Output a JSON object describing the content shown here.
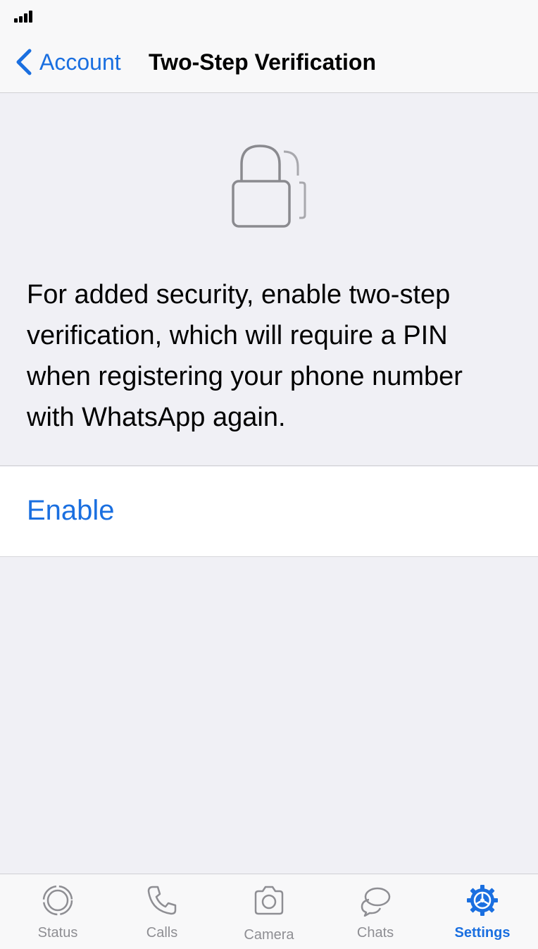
{
  "nav": {
    "back_label": "Account",
    "title": "Two-Step Verification"
  },
  "info": {
    "icon": "lock-icon",
    "description": "For added security, enable two-step verification, which will require a PIN when registering your phone number with WhatsApp again."
  },
  "actions": {
    "enable_label": "Enable"
  },
  "tabs": [
    {
      "label": "Status",
      "icon": "status-icon",
      "active": false
    },
    {
      "label": "Calls",
      "icon": "phone-icon",
      "active": false
    },
    {
      "label": "Camera",
      "icon": "camera-icon",
      "active": false
    },
    {
      "label": "Chats",
      "icon": "chat-bubbles-icon",
      "active": false
    },
    {
      "label": "Settings",
      "icon": "gear-icon",
      "active": true
    }
  ],
  "colors": {
    "accent": "#1a6fe0",
    "background": "#f0f0f5",
    "inactive_tab": "#8e8e93"
  }
}
